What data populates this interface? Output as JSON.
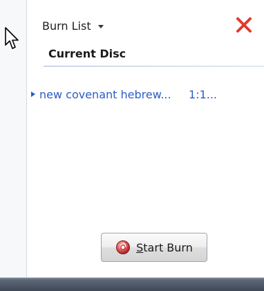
{
  "burn_list": {
    "dropdown_label": "Burn List",
    "section_title": "Current Disc",
    "items": [
      {
        "title": "new covenant hebrew...",
        "duration": "1:1..."
      }
    ],
    "start_burn_label": "Start Burn"
  },
  "colors": {
    "link_blue": "#2a5cc7",
    "close_red": "#e23a2a"
  }
}
